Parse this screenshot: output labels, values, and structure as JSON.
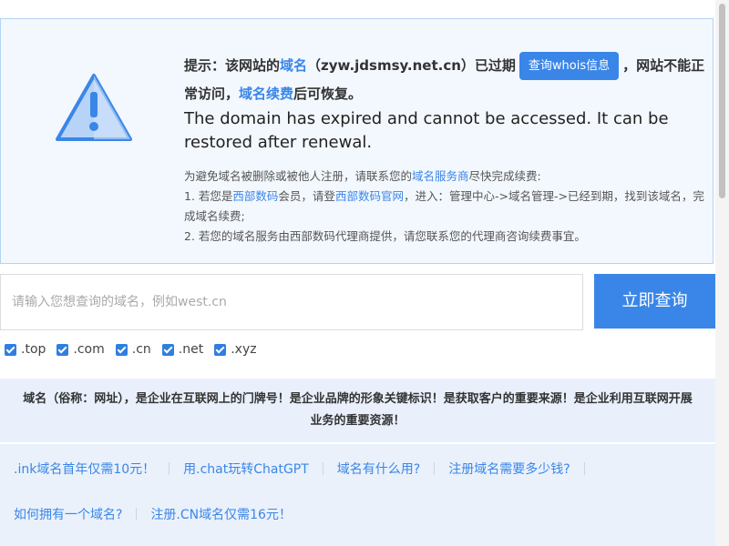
{
  "notice": {
    "zh_1": "提示：该网站的",
    "zh_domain": "域名",
    "zh_2": "（zyw.jdsmsy.net.cn）已过期",
    "whois_button": "查询whois信息",
    "zh_3": "，网站不能正常访问，",
    "zh_renew": "域名续费",
    "zh_4": "后可恢复。",
    "en": "The domain has expired and cannot be accessed. It can be restored after renewal.",
    "tip_1a": "为避免域名被删除或被他人注册，请联系您的",
    "tip_1_link": "域名服务商",
    "tip_1b": "尽快完成续费:",
    "tip_2a": "1. 若您是",
    "tip_2_link1": "西部数码",
    "tip_2b": "会员，请登",
    "tip_2_link2": "西部数码官网",
    "tip_2c": "，进入：管理中心->域名管理->已经到期，找到该域名，完成域名续费;",
    "tip_3": "2. 若您的域名服务由西部数码代理商提供，请您联系您的代理商咨询续费事宜。"
  },
  "search": {
    "placeholder": "请输入您想查询的域名，例如west.cn",
    "button": "立即查询"
  },
  "tlds": [
    {
      "label": ".top",
      "checked": true
    },
    {
      "label": ".com",
      "checked": true
    },
    {
      "label": ".cn",
      "checked": true
    },
    {
      "label": ".net",
      "checked": true
    },
    {
      "label": ".xyz",
      "checked": true
    }
  ],
  "intro": "域名（俗称：网址），是企业在互联网上的门牌号！是企业品牌的形象关键标识！是获取客户的重要来源！是企业利用互联网开展业务的重要资源！",
  "links_row1": [
    ".ink域名首年仅需10元！",
    "用.chat玩转ChatGPT",
    "域名有什么用?",
    "注册域名需要多少钱?"
  ],
  "links_row2": [
    "如何拥有一个域名?",
    "注册.CN域名仅需16元！"
  ],
  "colors": {
    "accent": "#3a86e8",
    "notice_bg": "#f3f8fe",
    "notice_border": "#b3d3f5",
    "intro_bg": "#e9f0fc"
  }
}
